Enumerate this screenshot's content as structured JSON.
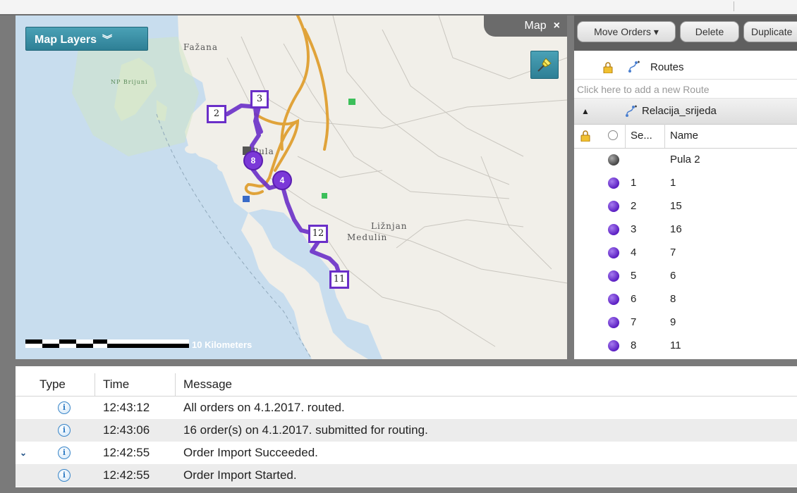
{
  "map": {
    "layers_button": "Map Layers",
    "tab_label": "Map",
    "tab_close": "×",
    "places": {
      "fazana": "Fažana",
      "np_brijuni": "NP Brijuni",
      "pula": "Pula",
      "liznjan": "Ližnjan",
      "medulin": "Medulin"
    },
    "scale_label": "10 Kilometers",
    "stops": [
      "2",
      "3",
      "8",
      "4",
      "12",
      "11"
    ],
    "route_color": "#6a2fc8"
  },
  "right_panel": {
    "toolbar": {
      "move_orders": "Move Orders ▾",
      "delete": "Delete",
      "duplicate": "Duplicate"
    },
    "routes_header": "Routes",
    "add_route_placeholder": "Click here to add a new Route",
    "route_name": "Relacija_srijeda",
    "columns": {
      "seq": "Se...",
      "name": "Name"
    },
    "stops": [
      {
        "seq": "",
        "name": "Pula 2",
        "kind": "depot"
      },
      {
        "seq": "1",
        "name": "1",
        "kind": "order"
      },
      {
        "seq": "2",
        "name": "15",
        "kind": "order"
      },
      {
        "seq": "3",
        "name": "16",
        "kind": "order"
      },
      {
        "seq": "4",
        "name": "7",
        "kind": "order"
      },
      {
        "seq": "5",
        "name": "6",
        "kind": "order"
      },
      {
        "seq": "6",
        "name": "8",
        "kind": "order"
      },
      {
        "seq": "7",
        "name": "9",
        "kind": "order"
      },
      {
        "seq": "8",
        "name": "11",
        "kind": "order"
      }
    ]
  },
  "log": {
    "columns": {
      "type": "Type",
      "time": "Time",
      "message": "Message"
    },
    "rows": [
      {
        "time": "12:43:12",
        "message": "All orders on 4.1.2017. routed."
      },
      {
        "time": "12:43:06",
        "message": "16 order(s) on 4.1.2017. submitted for routing."
      },
      {
        "time": "12:42:55",
        "message": "Order Import Succeeded."
      },
      {
        "time": "12:42:55",
        "message": "Order Import Started."
      }
    ]
  }
}
